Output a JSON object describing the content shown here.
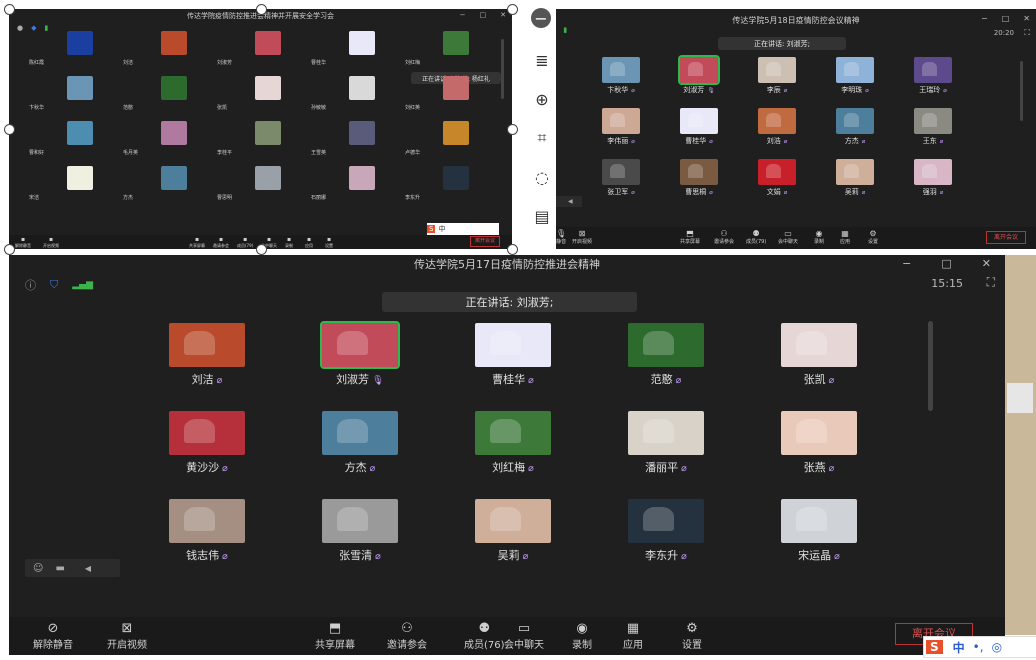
{
  "bottom": {
    "title": "传达学院5月17日疫情防控推进会精神",
    "time": "15:15",
    "speaking_label": "正在讲话: 刘淑芳;",
    "participants": [
      {
        "name": "刘洁",
        "bg": "#b94a2b",
        "active": false
      },
      {
        "name": "刘淑芳",
        "bg": "#c24b5a",
        "active": true
      },
      {
        "name": "曹桂华",
        "bg": "#e8e8f8",
        "active": false
      },
      {
        "name": "范憨",
        "bg": "#2d6a2d",
        "active": false
      },
      {
        "name": "张凯",
        "bg": "#e7d6d6",
        "active": false
      },
      {
        "name": "黄沙沙",
        "bg": "#b5303a",
        "active": false
      },
      {
        "name": "方杰",
        "bg": "#4d7e9c",
        "active": false
      },
      {
        "name": "刘红梅",
        "bg": "#3d7a3a",
        "active": false
      },
      {
        "name": "潘丽平",
        "bg": "#d8d2c8",
        "active": false
      },
      {
        "name": "张燕",
        "bg": "#e9c9b9",
        "active": false
      },
      {
        "name": "钱志伟",
        "bg": "#a58f82",
        "active": false
      },
      {
        "name": "张雪清",
        "bg": "#9a9a9a",
        "active": false
      },
      {
        "name": "吴莉",
        "bg": "#cfae9a",
        "active": false
      },
      {
        "name": "李东升",
        "bg": "#24313e",
        "active": false
      },
      {
        "name": "宋运晶",
        "bg": "#cfd3d8",
        "active": false
      },
      {
        "name": "",
        "bg": "#6a7a9a",
        "active": false
      },
      {
        "name": "",
        "bg": "#c9702a",
        "active": false
      },
      {
        "name": "",
        "bg": "#8a8a8a",
        "active": false
      },
      {
        "name": "",
        "bg": "#e6a040",
        "active": false
      },
      {
        "name": "",
        "bg": "#a85a3a",
        "active": false
      }
    ],
    "toolbar": [
      {
        "label": "解除静音",
        "icon": "mic-muted-icon"
      },
      {
        "label": "开启视频",
        "icon": "video-off-icon"
      },
      {
        "label": "共享屏幕",
        "icon": "share-screen-icon"
      },
      {
        "label": "邀请参会",
        "icon": "invite-icon"
      },
      {
        "label": "成员(76)",
        "icon": "members-icon"
      },
      {
        "label": "会中聊天",
        "icon": "chat-icon"
      },
      {
        "label": "录制",
        "icon": "record-icon"
      },
      {
        "label": "应用",
        "icon": "apps-icon"
      },
      {
        "label": "设置",
        "icon": "settings-icon"
      }
    ],
    "leave_label": "离开会议"
  },
  "top_right": {
    "title": "传达学院5月18日疫情防控会议精神",
    "time": "20:20",
    "speaking_label": "正在讲话: 刘淑芳;",
    "participants": [
      {
        "name": "卞秋华",
        "bg": "#6b95b5",
        "active": false
      },
      {
        "name": "刘淑芳",
        "bg": "#c24b5a",
        "active": true
      },
      {
        "name": "李辰",
        "bg": "#cdbfb2",
        "active": false
      },
      {
        "name": "李明珠",
        "bg": "#8fb3d8",
        "active": false
      },
      {
        "name": "王瑞玲",
        "bg": "#5d4a8c",
        "active": false
      },
      {
        "name": "李伟丽",
        "bg": "#cda895",
        "active": false
      },
      {
        "name": "曹桂华",
        "bg": "#e8e8f8",
        "active": false
      },
      {
        "name": "刘浩",
        "bg": "#c06a40",
        "active": false
      },
      {
        "name": "方杰",
        "bg": "#4d7e9c",
        "active": false
      },
      {
        "name": "王东",
        "bg": "#8a8a82",
        "active": false
      },
      {
        "name": "张卫军",
        "bg": "#4a4a4a",
        "active": false
      },
      {
        "name": "曹思桐",
        "bg": "#7a5a40",
        "active": false
      },
      {
        "name": "文娟",
        "bg": "#c8202a",
        "active": false
      },
      {
        "name": "吴莉",
        "bg": "#cfae9a",
        "active": false
      },
      {
        "name": "强羽",
        "bg": "#d8b6c6",
        "active": false
      },
      {
        "name": "",
        "bg": "#b84a4a",
        "active": false
      },
      {
        "name": "",
        "bg": "#6a5a8a",
        "active": false
      },
      {
        "name": "",
        "bg": "#3d6a3a",
        "active": false
      },
      {
        "name": "",
        "bg": "#8a9aaa",
        "active": false
      },
      {
        "name": "",
        "bg": "#c8c8c8",
        "active": false
      }
    ],
    "toolbar": [
      {
        "label": "静音",
        "icon": "mic-icon"
      },
      {
        "label": "开启视频",
        "icon": "video-off-icon"
      },
      {
        "label": "共享屏幕",
        "icon": "share-screen-icon"
      },
      {
        "label": "邀请参会",
        "icon": "invite-icon"
      },
      {
        "label": "成员(79)",
        "icon": "members-icon"
      },
      {
        "label": "会中聊天",
        "icon": "chat-icon"
      },
      {
        "label": "录制",
        "icon": "record-icon"
      },
      {
        "label": "应用",
        "icon": "apps-icon"
      },
      {
        "label": "设置",
        "icon": "settings-icon"
      }
    ],
    "leave_label": "离开会议"
  },
  "top_left": {
    "title": "传达学院疫情防控推进会精神并开展安全学习会",
    "speaking_label": "正在讲话: 刘淑芳; 杨红礼",
    "participants": [
      {
        "name": "陈红霞",
        "bg": "#1b3fa0"
      },
      {
        "name": "刘洁",
        "bg": "#b94a2b"
      },
      {
        "name": "刘淑芳",
        "bg": "#c24b5a"
      },
      {
        "name": "曹桂华",
        "bg": "#e8e8f8"
      },
      {
        "name": "刘红梅",
        "bg": "#3d7a3a"
      },
      {
        "name": "卞秋华",
        "bg": "#6b95b5"
      },
      {
        "name": "范憨",
        "bg": "#2d6a2d"
      },
      {
        "name": "张凯",
        "bg": "#e7d6d6"
      },
      {
        "name": "孙敏敏",
        "bg": "#d9d9d9"
      },
      {
        "name": "刘红英",
        "bg": "#c46a6a"
      },
      {
        "name": "曹和好",
        "bg": "#4d8eb0"
      },
      {
        "name": "毛月英",
        "bg": "#b07aa0"
      },
      {
        "name": "李桂平",
        "bg": "#7a8a6a"
      },
      {
        "name": "王雪英",
        "bg": "#5a5a7a"
      },
      {
        "name": "卢德华",
        "bg": "#c8862a"
      },
      {
        "name": "宋洁",
        "bg": "#f0f0e0"
      },
      {
        "name": "方杰",
        "bg": "#4d7e9c"
      },
      {
        "name": "曹思明",
        "bg": "#9aa0a8"
      },
      {
        "name": "石丽娜",
        "bg": "#c8a8b8"
      },
      {
        "name": "李东升",
        "bg": "#24313e"
      }
    ],
    "toolbar": [
      {
        "label": "解除静音"
      },
      {
        "label": "开启视频"
      },
      {
        "label": "共享屏幕"
      },
      {
        "label": "邀请参会"
      },
      {
        "label": "成员(79)"
      },
      {
        "label": "会中聊天"
      },
      {
        "label": "录制"
      },
      {
        "label": "应用"
      },
      {
        "label": "设置"
      }
    ],
    "leave_label": "离开会议",
    "ime_label": "中"
  },
  "side_tools": [
    {
      "icon": "minus-icon",
      "glyph": "−"
    },
    {
      "icon": "list-icon",
      "glyph": "≣"
    },
    {
      "icon": "zoom-in-icon",
      "glyph": "⊕"
    },
    {
      "icon": "crop-icon",
      "glyph": "⌗"
    },
    {
      "icon": "lightbulb-icon",
      "glyph": "◌"
    },
    {
      "icon": "document-icon",
      "glyph": "▤"
    },
    {
      "icon": "more-icon",
      "glyph": "⋯"
    }
  ],
  "ime_bottom": {
    "label": "中"
  }
}
